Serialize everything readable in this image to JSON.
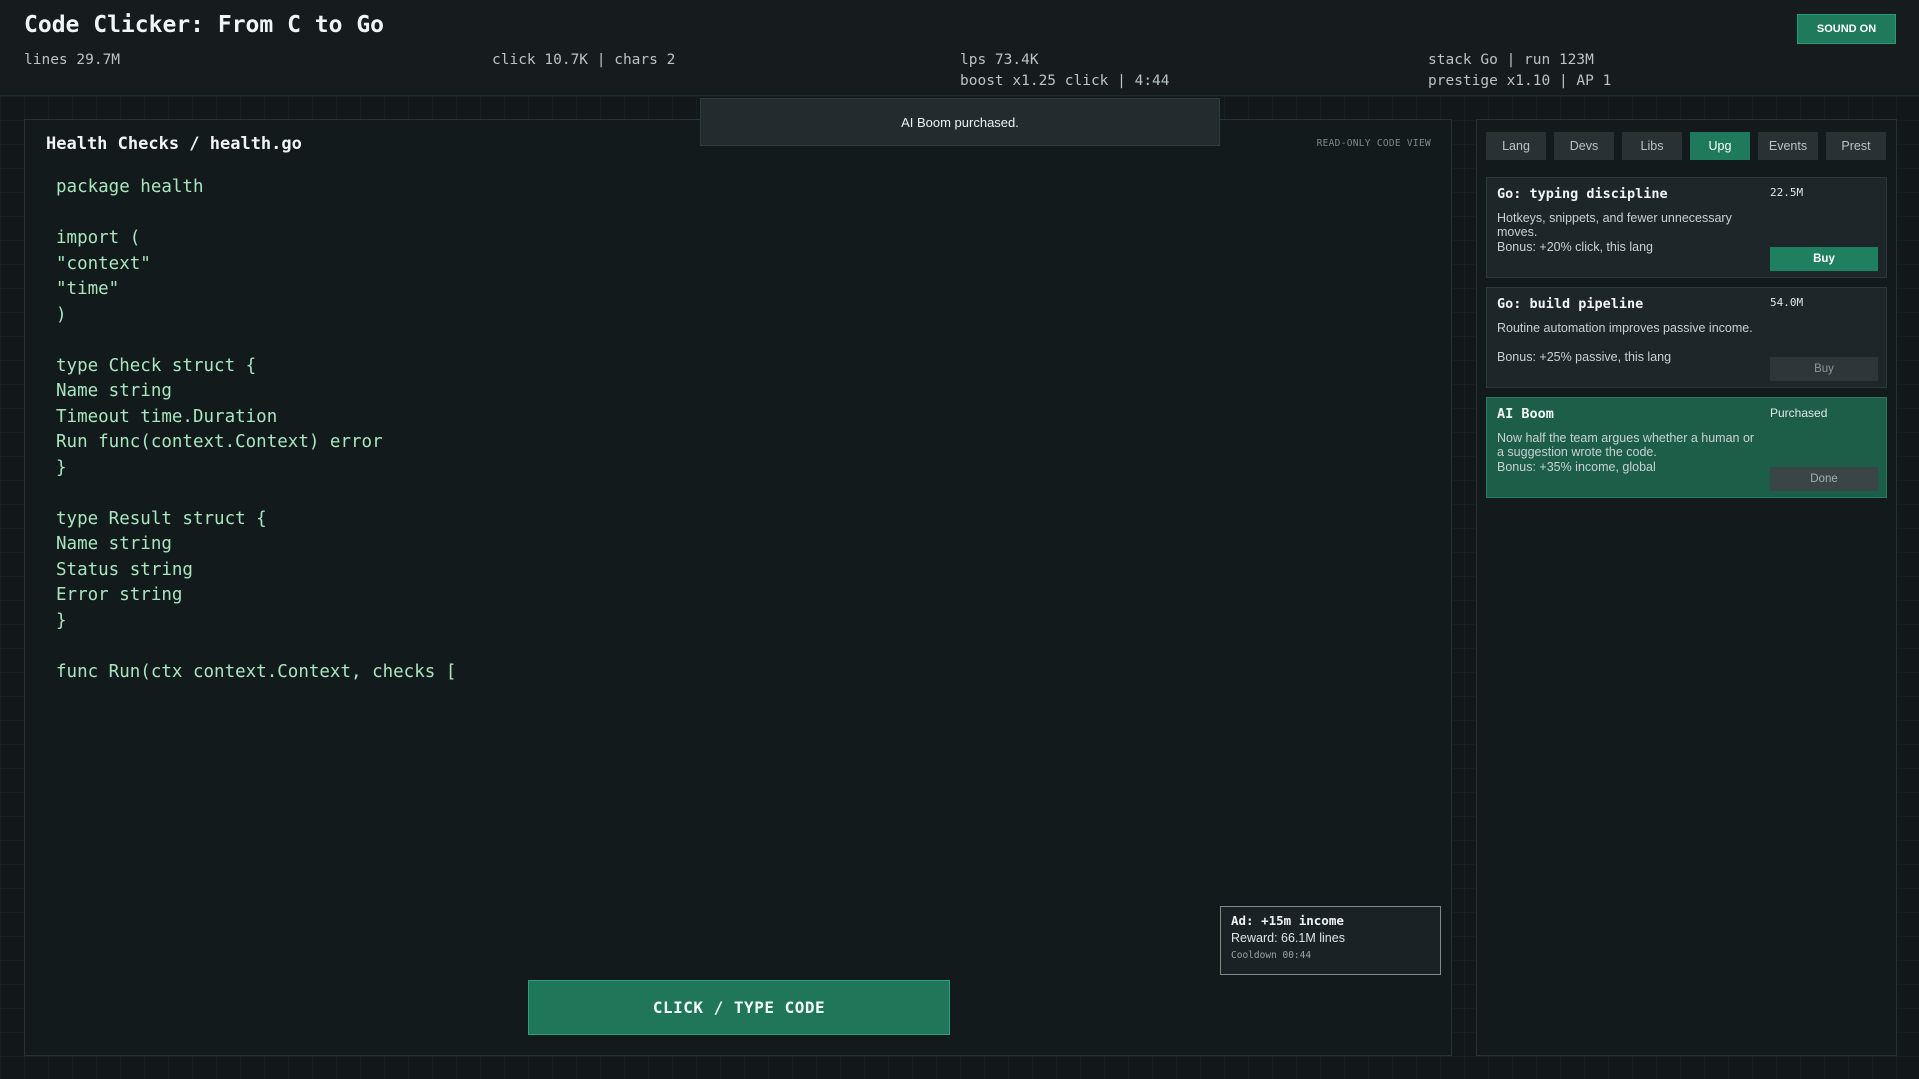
{
  "header": {
    "title": "Code Clicker: From C to Go",
    "stats": {
      "lines": "lines 29.7M",
      "click_chars": "click 10.7K | chars 2",
      "lps": "lps 73.4K",
      "boost": "boost x1.25 click | 4:44",
      "stack_run": "stack Go | run 123M",
      "prestige": "prestige x1.10 | AP 1"
    },
    "sound_label": "SOUND ON"
  },
  "toast": {
    "message": "AI Boom purchased."
  },
  "editor": {
    "title": "Health Checks / health.go",
    "readonly_label": "READ-ONLY CODE VIEW",
    "code_lines": [
      "package health",
      "",
      "import (",
      "\"context\"",
      "\"time\"",
      ")",
      "",
      "type Check struct {",
      "Name string",
      "Timeout time.Duration",
      "Run func(context.Context) error",
      "}",
      "",
      "type Result struct {",
      "Name string",
      "Status string",
      "Error string",
      "}",
      "",
      "func Run(ctx context.Context, checks ["
    ],
    "click_button": "CLICK / TYPE CODE"
  },
  "ad": {
    "title": "Ad: +15m income",
    "reward": "Reward: 66.1M lines",
    "cooldown": "Cooldown 00:44"
  },
  "side": {
    "tabs": [
      {
        "label": "Lang",
        "active": false
      },
      {
        "label": "Devs",
        "active": false
      },
      {
        "label": "Libs",
        "active": false
      },
      {
        "label": "Upg",
        "active": true
      },
      {
        "label": "Events",
        "active": false
      },
      {
        "label": "Prest",
        "active": false
      }
    ],
    "upgrades": [
      {
        "title": "Go: typing discipline",
        "description": "Hotkeys, snippets, and fewer unnecessary moves.",
        "bonus": "Bonus: +20% click, this lang",
        "cost": "22.5M",
        "button": "Buy",
        "state": "enabled"
      },
      {
        "title": "Go: build pipeline",
        "description": "Routine automation improves passive income.",
        "bonus": "Bonus: +25% passive, this lang",
        "cost": "54.0M",
        "button": "Buy",
        "state": "disabled"
      },
      {
        "title": "AI Boom",
        "description": "Now half the team argues whether a human or a suggestion wrote the code.",
        "bonus": "Bonus: +35% income, global",
        "cost": "Purchased",
        "button": "Done",
        "state": "done"
      }
    ]
  },
  "colors": {
    "accent": "#1f7a5b",
    "background": "#121719",
    "code_text": "#a8e6bf",
    "purchased_card": "#1c5e48"
  }
}
